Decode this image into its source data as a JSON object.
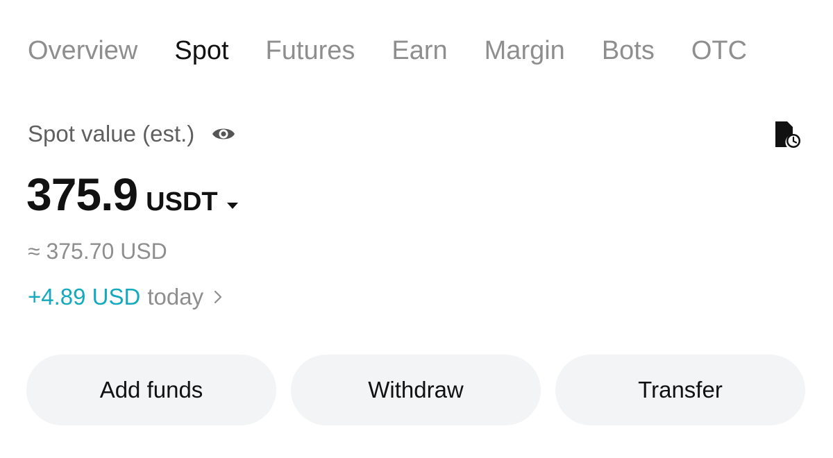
{
  "tabs": [
    {
      "label": "Overview",
      "active": false
    },
    {
      "label": "Spot",
      "active": true
    },
    {
      "label": "Futures",
      "active": false
    },
    {
      "label": "Earn",
      "active": false
    },
    {
      "label": "Margin",
      "active": false
    },
    {
      "label": "Bots",
      "active": false
    },
    {
      "label": "OTC",
      "active": false
    }
  ],
  "balance": {
    "label": "Spot value (est.)",
    "amount": "375.9",
    "currency": "USDT",
    "approx": "≈ 375.70 USD",
    "pnl_value": "+4.89 USD",
    "pnl_period": "today"
  },
  "icons": {
    "visibility": "eye-icon",
    "history": "document-clock-icon",
    "currency_dropdown": "caret-down-icon",
    "pnl_details": "chevron-right-icon"
  },
  "actions": {
    "add_funds": "Add funds",
    "withdraw": "Withdraw",
    "transfer": "Transfer"
  },
  "colors": {
    "positive": "#14a9bd",
    "muted": "#8e8e8e",
    "button_bg": "#f3f4f5"
  }
}
